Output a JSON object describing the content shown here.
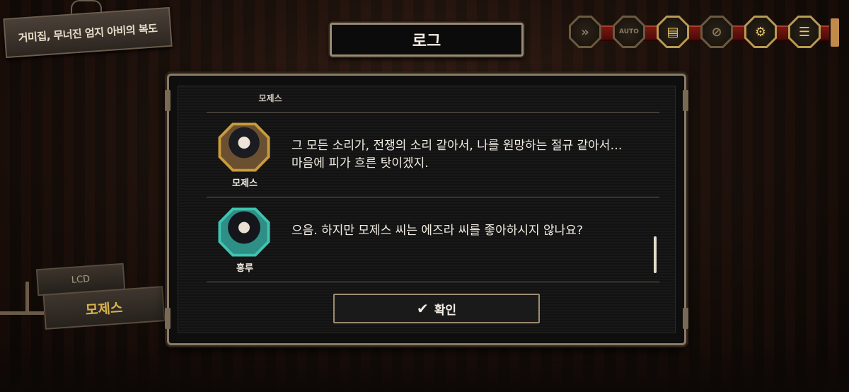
{
  "location": {
    "title": "거미집, 무너진 엄지 아비의 복도"
  },
  "log": {
    "title": "로그",
    "entries": [
      {
        "speaker": "모제스",
        "text": ""
      },
      {
        "speaker": "모제스",
        "text": "그 모든 소리가, 전쟁의 소리 같아서, 나를 원망하는 절규 같아서… 마음에 피가 흐른 탓이겠지."
      },
      {
        "speaker": "홍루",
        "text": "으음. 하지만 모제스 씨는 에즈라 씨를 좋아하시지 않나요?"
      }
    ],
    "confirm_label": "확인"
  },
  "controls": {
    "items": [
      {
        "icon": "fast-forward-icon",
        "symbol": "»"
      },
      {
        "icon": "auto-icon",
        "symbol": "AUTO"
      },
      {
        "icon": "log-book-icon",
        "symbol": "▤"
      },
      {
        "icon": "hide-ui-icon",
        "symbol": "⊘"
      },
      {
        "icon": "settings-gear-icon",
        "symbol": "⚙"
      },
      {
        "icon": "menu-icon",
        "symbol": "☰"
      }
    ]
  },
  "nameplate": {
    "tag": "LCD",
    "name": "모제스"
  }
}
